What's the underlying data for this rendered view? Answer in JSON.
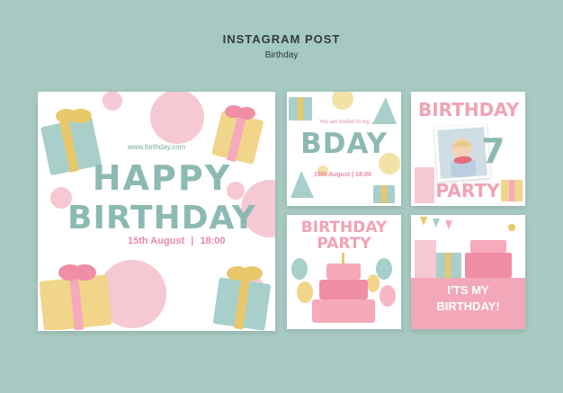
{
  "header": {
    "title": "INSTAGRAM POST",
    "subtitle": "Birthday"
  },
  "post_main": {
    "url": "www.birthday.com",
    "line1": "HAPPY",
    "line2": "BIRTHDAY",
    "date": "15th August",
    "time": "18:00"
  },
  "post_bday": {
    "invite": "You are invited to my...",
    "title": "BDAY",
    "date": "15th August",
    "time": "18:00"
  },
  "post_photo": {
    "line1": "BIRTHDAY",
    "number": "7",
    "line2": "PARTY"
  },
  "post_cake": {
    "line1": "BIRTHDAY",
    "line2": "PARTY"
  },
  "post_my": {
    "line1": "I'TS MY",
    "line2": "BIRTHDAY!"
  },
  "colors": {
    "background": "#a6c9c1",
    "teal": "#8db9b3",
    "pink": "#f0a3b6",
    "gold": "#e8c86a"
  }
}
